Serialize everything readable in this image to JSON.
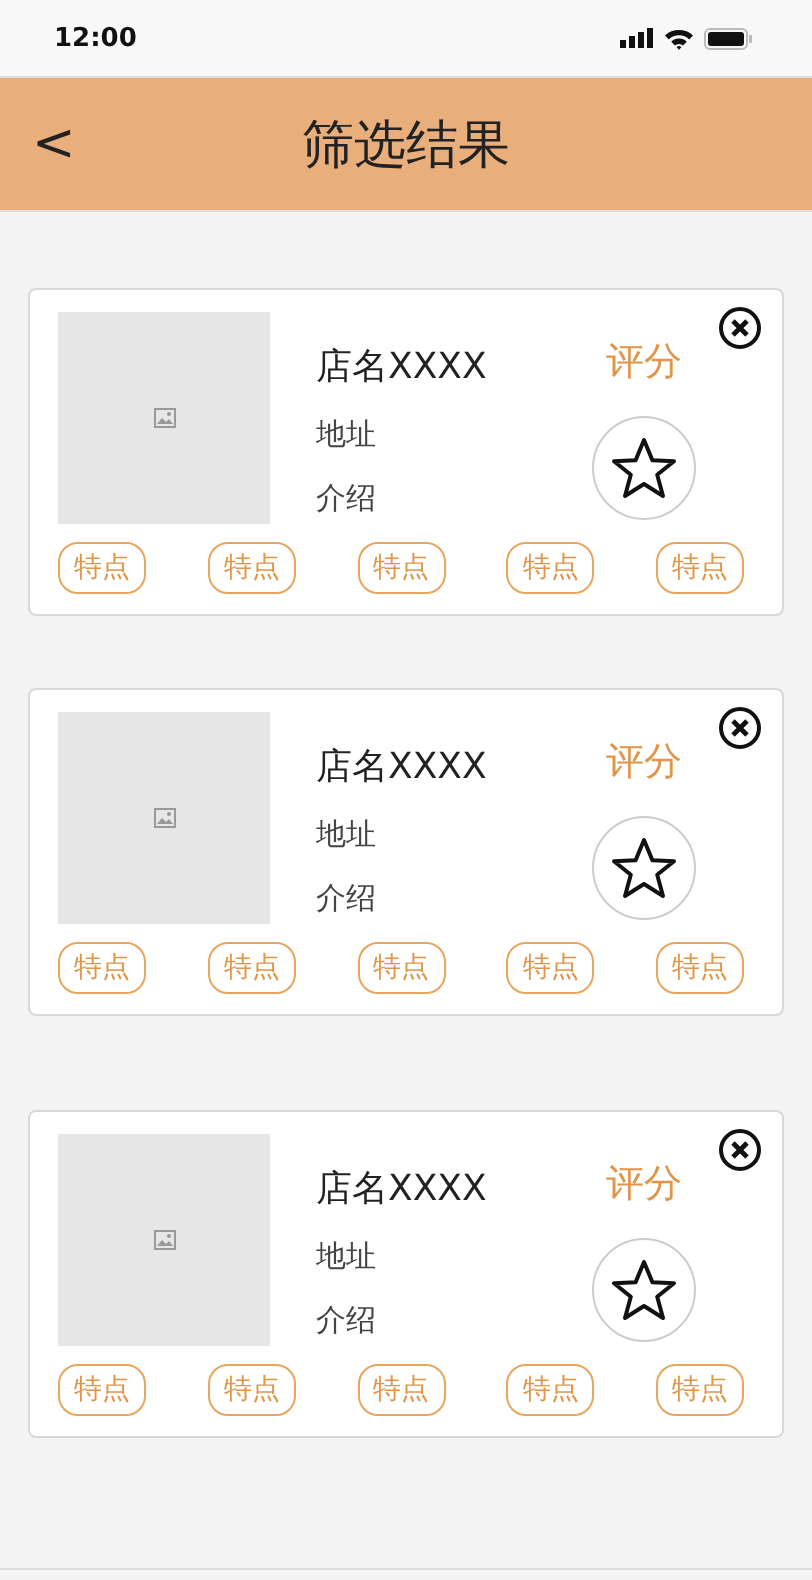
{
  "status_bar": {
    "time": "12:00"
  },
  "header": {
    "back": "<",
    "title": "筛选结果"
  },
  "cards": [
    {
      "name": "店名XXXX",
      "address": "地址",
      "intro": "介绍",
      "rating_label": "评分",
      "tags": [
        "特点",
        "特点",
        "特点",
        "特点",
        "特点"
      ]
    },
    {
      "name": "店名XXXX",
      "address": "地址",
      "intro": "介绍",
      "rating_label": "评分",
      "tags": [
        "特点",
        "特点",
        "特点",
        "特点",
        "特点"
      ]
    },
    {
      "name": "店名XXXX",
      "address": "地址",
      "intro": "介绍",
      "rating_label": "评分",
      "tags": [
        "特点",
        "特点",
        "特点",
        "特点",
        "特点"
      ]
    }
  ]
}
